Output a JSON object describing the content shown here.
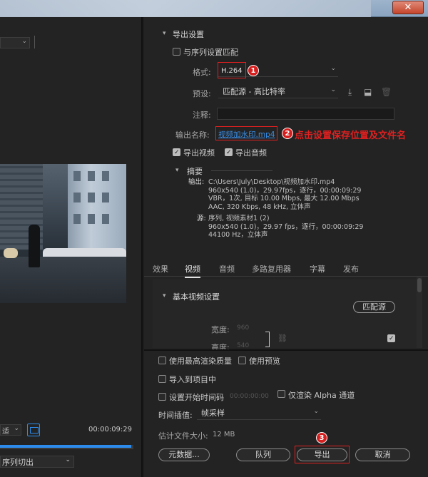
{
  "window": {
    "close_label": "✕"
  },
  "left": {
    "timecode": "00:00:09:29",
    "sequence_select": "序列切出",
    "fit_select": "适"
  },
  "export_settings": {
    "title": "导出设置",
    "match_sequence": "与序列设置匹配",
    "format_label": "格式:",
    "format_value": "H.264",
    "preset_label": "预设:",
    "preset_value": "匹配源 - 高比特率",
    "comment_label": "注释:",
    "comment_value": "",
    "output_name_label": "输出名称:",
    "output_name_value": "视频加水印.mp4",
    "export_video": "导出视频",
    "export_audio": "导出音频",
    "summary_title": "摘要",
    "output_key": "输出:",
    "output_lines": [
      "C:\\Users\\July\\Desktop\\视频加水印.mp4",
      "960x540 (1.0)，29.97fps，逐行，00:00:09:29",
      "VBR，1次, 目标 10.00 Mbps, 最大 12.00 Mbps",
      "AAC, 320 Kbps, 48  kHz, 立体声"
    ],
    "source_key": "源:",
    "source_lines": [
      "序列, 视频素材1 (2)",
      "960x540 (1.0)，29.97 fps，逐行，00:00:09:29",
      "44100 Hz，立体声"
    ]
  },
  "annotations": {
    "badge1": "1",
    "badge2": "2",
    "badge3": "3",
    "note2": "点击设置保存位置及文件名"
  },
  "tabs": [
    "效果",
    "视频",
    "音频",
    "多路复用器",
    "字幕",
    "发布"
  ],
  "video_settings": {
    "title": "基本视频设置",
    "match_source": "匹配源",
    "width_label": "宽度:",
    "width_value": "960",
    "height_label": "高度:",
    "height_value": "540"
  },
  "bottom": {
    "max_render": "使用最高渲染质量",
    "use_preview": "使用预览",
    "import_project": "导入到项目中",
    "set_start_tc": "设置开始时间码",
    "start_tc": "00:00:00:00",
    "render_alpha": "仅渲染 Alpha 通道",
    "interp_label": "时间插值:",
    "interp_value": "帧采样",
    "filesize_label": "估计文件大小:",
    "filesize_value": "12 MB",
    "metadata_btn": "元数据...",
    "queue_btn": "队列",
    "export_btn": "导出",
    "cancel_btn": "取消"
  },
  "colors": {
    "accent": "#2d8ceb",
    "annotation": "#e02020",
    "background": "#232323"
  }
}
